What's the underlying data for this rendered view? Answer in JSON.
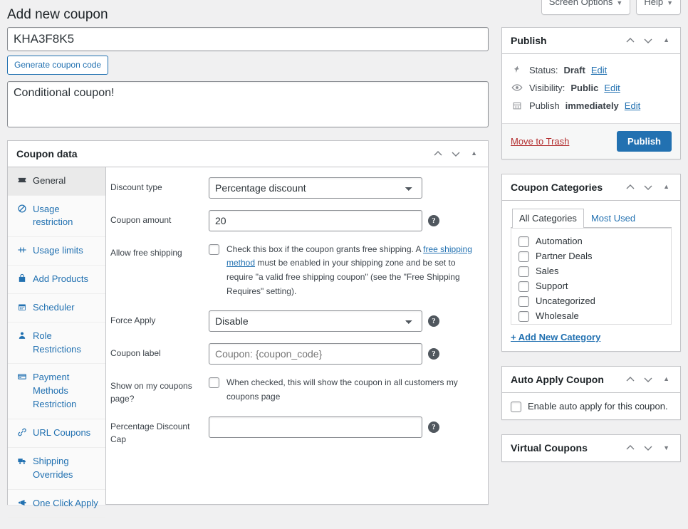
{
  "screen_meta": {
    "screen_options_label": "Screen Options",
    "help_label": "Help",
    "caret": "▼"
  },
  "page_title": "Add new coupon",
  "coupon_code": {
    "value": "KHA3F8K5",
    "generate_label": "Generate coupon code"
  },
  "description": {
    "value": "Conditional coupon!"
  },
  "coupon_data": {
    "panel_title": "Coupon data",
    "tabs": [
      {
        "label": "General",
        "icon": "ticket-icon",
        "active": true
      },
      {
        "label": "Usage restriction",
        "icon": "block-icon",
        "active": false
      },
      {
        "label": "Usage limits",
        "icon": "sliders-icon",
        "active": false
      },
      {
        "label": "Add Products",
        "icon": "bag-icon",
        "active": false
      },
      {
        "label": "Scheduler",
        "icon": "calendar-icon",
        "active": false
      },
      {
        "label": "Role Restrictions",
        "icon": "person-icon",
        "active": false
      },
      {
        "label": "Payment Methods Restriction",
        "icon": "credit-card-icon",
        "active": false
      },
      {
        "label": "URL Coupons",
        "icon": "link-icon",
        "active": false
      },
      {
        "label": "Shipping Overrides",
        "icon": "truck-icon",
        "active": false
      },
      {
        "label": "One Click Apply",
        "icon": "megaphone-icon",
        "active": false
      }
    ],
    "fields": {
      "discount_type_label": "Discount type",
      "discount_type_value": "Percentage discount",
      "coupon_amount_label": "Coupon amount",
      "coupon_amount_value": "20",
      "free_shipping_label": "Allow free shipping",
      "free_shipping_text_1": "Check this box if the coupon grants free shipping. A ",
      "free_shipping_link": "free shipping method",
      "free_shipping_text_2": " must be enabled in your shipping zone and be set to require \"a valid free shipping coupon\" (see the \"Free Shipping Requires\" setting).",
      "force_apply_label": "Force Apply",
      "force_apply_value": "Disable",
      "coupon_label_label": "Coupon label",
      "coupon_label_placeholder": "Coupon: {coupon_code}",
      "show_my_coupons_label": "Show on my coupons page?",
      "show_my_coupons_text": "When checked, this will show the coupon in all customers my coupons page",
      "percentage_cap_label": "Percentage Discount Cap",
      "percentage_cap_value": ""
    }
  },
  "publish": {
    "panel_title": "Publish",
    "status_prefix": "Status:",
    "status_value": "Draft",
    "status_edit": "Edit",
    "visibility_prefix": "Visibility:",
    "visibility_value": "Public",
    "visibility_edit": "Edit",
    "schedule_prefix": "Publish",
    "schedule_value": "immediately",
    "schedule_edit": "Edit",
    "trash_label": "Move to Trash",
    "publish_label": "Publish"
  },
  "categories": {
    "panel_title": "Coupon Categories",
    "tab_all": "All Categories",
    "tab_most_used": "Most Used",
    "items": [
      {
        "label": "Automation",
        "checked": false
      },
      {
        "label": "Partner Deals",
        "checked": false
      },
      {
        "label": "Sales",
        "checked": false
      },
      {
        "label": "Support",
        "checked": false
      },
      {
        "label": "Uncategorized",
        "checked": false
      },
      {
        "label": "Wholesale",
        "checked": false
      }
    ],
    "add_new_label": "+ Add New Category"
  },
  "auto_apply": {
    "panel_title": "Auto Apply Coupon",
    "checkbox_label": "Enable auto apply for this coupon.",
    "checked": false
  },
  "virtual_coupons": {
    "panel_title": "Virtual Coupons"
  },
  "colors": {
    "accent": "#2271b1",
    "page_bg": "#f0f0f1",
    "border": "#c3c4c7",
    "danger": "#b32d2e"
  }
}
